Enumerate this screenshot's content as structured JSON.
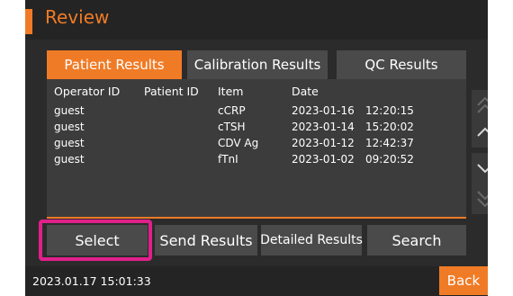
{
  "header": {
    "title": "Review"
  },
  "tabs": [
    {
      "label": "Patient Results",
      "active": true
    },
    {
      "label": "Calibration Results",
      "active": false
    },
    {
      "label": "QC Results",
      "active": false
    }
  ],
  "table": {
    "columns": [
      "Operator ID",
      "Patient ID",
      "Item",
      "Date"
    ],
    "rows": [
      {
        "operator": "guest",
        "patient": "",
        "item": "cCRP",
        "date": "2023-01-16",
        "time": "12:20:15"
      },
      {
        "operator": "guest",
        "patient": "",
        "item": "cTSH",
        "date": "2023-01-14",
        "time": "15:20:02"
      },
      {
        "operator": "guest",
        "patient": "",
        "item": "CDV Ag",
        "date": "2023-01-12",
        "time": "12:42:37"
      },
      {
        "operator": "guest",
        "patient": "",
        "item": "fTnI",
        "date": "2023-01-02",
        "time": "09:20:52"
      }
    ]
  },
  "scroll": {
    "page_up_icon": "double-chevron-up-icon",
    "up_icon": "chevron-up-icon",
    "down_icon": "chevron-down-icon",
    "page_down_icon": "double-chevron-down-icon"
  },
  "actions": {
    "select_label": "Select",
    "send_label": "Send Results",
    "detailed_label": "Detailed Results",
    "search_label": "Search"
  },
  "status": {
    "datetime": "2023.01.17  15:01:33",
    "back_label": "Back"
  },
  "colors": {
    "accent": "#f07b26",
    "highlight": "#e0208a",
    "background": "#2b2b2b"
  }
}
